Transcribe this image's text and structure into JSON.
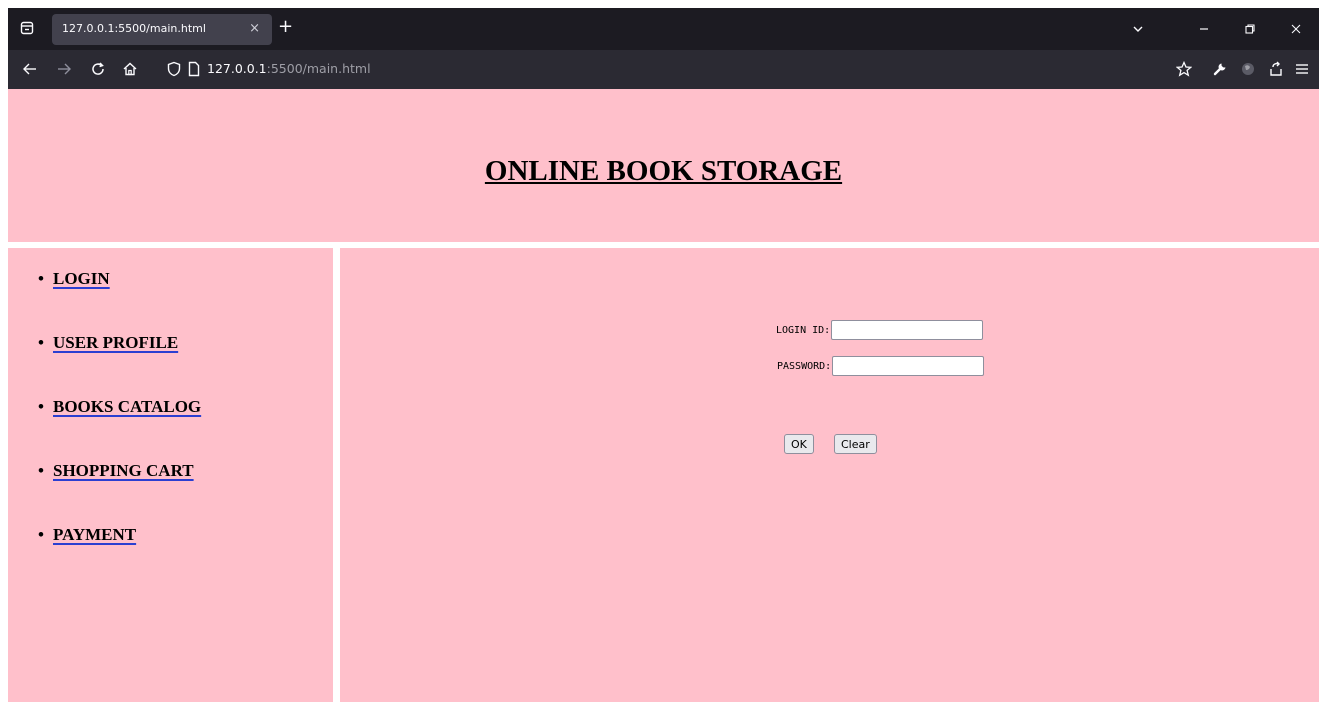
{
  "browser": {
    "tab": {
      "title": "127.0.0.1:5500/main.html",
      "close_glyph": "×"
    },
    "new_tab_glyph": "+",
    "url": {
      "host": "127.0.0.1",
      "path": ":5500/main.html"
    },
    "icons": [
      "tab-list-icon",
      "back-icon",
      "forward-icon",
      "reload-icon",
      "home-icon",
      "shield-icon",
      "page-icon",
      "bookmark-star-icon",
      "wrench-icon",
      "extension-icon",
      "share-icon",
      "menu-icon",
      "chevron-down-icon",
      "minimize-icon",
      "restore-icon",
      "close-icon"
    ]
  },
  "header": {
    "title": "ONLINE BOOK STORAGE"
  },
  "sidebar": {
    "bullet": "•",
    "items": [
      {
        "label": "LOGIN"
      },
      {
        "label": "USER PROFILE"
      },
      {
        "label": "BOOKS CATALOG"
      },
      {
        "label": "SHOPPING CART"
      },
      {
        "label": "PAYMENT"
      }
    ]
  },
  "form": {
    "login_label": "LOGIN ID:",
    "login_value": "",
    "password_label": "PASSWORD:",
    "password_value": "",
    "ok_label": "OK",
    "clear_label": "Clear"
  },
  "colors": {
    "page_background": "#ffc0cb",
    "link_underline": "#2b3fd1",
    "chrome_dark": "#1c1b22",
    "toolbar": "#2b2a33"
  }
}
